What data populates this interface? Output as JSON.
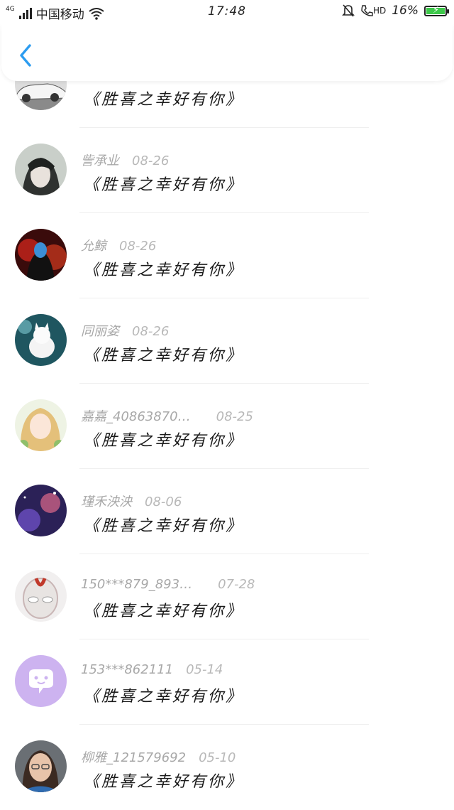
{
  "status_bar": {
    "network": "4G",
    "carrier": "中国移动",
    "time": "17:48",
    "hd": "HD",
    "battery": "16%"
  },
  "conversations": [
    {
      "name": "",
      "date": "",
      "message": "《胜喜之幸好有你》",
      "avatar_icon": "car-avatar"
    },
    {
      "name": "訾承业",
      "date": "08-26",
      "message": "《胜喜之幸好有你》",
      "avatar_icon": "anime-boy-avatar"
    },
    {
      "name": "允鲸",
      "date": "08-26",
      "message": "《胜喜之幸好有你》",
      "avatar_icon": "red-hooded-avatar"
    },
    {
      "name": "同丽姿",
      "date": "08-26",
      "message": "《胜喜之幸好有你》",
      "avatar_icon": "white-cat-avatar"
    },
    {
      "name": "嘉嘉_40863870…",
      "date": "08-25",
      "message": "《胜喜之幸好有你》",
      "avatar_icon": "anime-girl-avatar"
    },
    {
      "name": "瑾禾泱泱",
      "date": "08-06",
      "message": "《胜喜之幸好有你》",
      "avatar_icon": "purple-scene-avatar"
    },
    {
      "name": "150***879_893…",
      "date": "07-28",
      "message": "《胜喜之幸好有你》",
      "avatar_icon": "ultraman-avatar"
    },
    {
      "name": "153***862111",
      "date": "05-14",
      "message": "《胜喜之幸好有你》",
      "avatar_icon": "chat-bubble-avatar"
    },
    {
      "name": "柳雅_121579692",
      "date": "05-10",
      "message": "《胜喜之幸好有你》",
      "avatar_icon": "woman-photo-avatar"
    }
  ],
  "colors": {
    "back_arrow": "#2c9cf0",
    "meta_text": "#a8a8a8",
    "message_text": "#1a1a1a"
  }
}
